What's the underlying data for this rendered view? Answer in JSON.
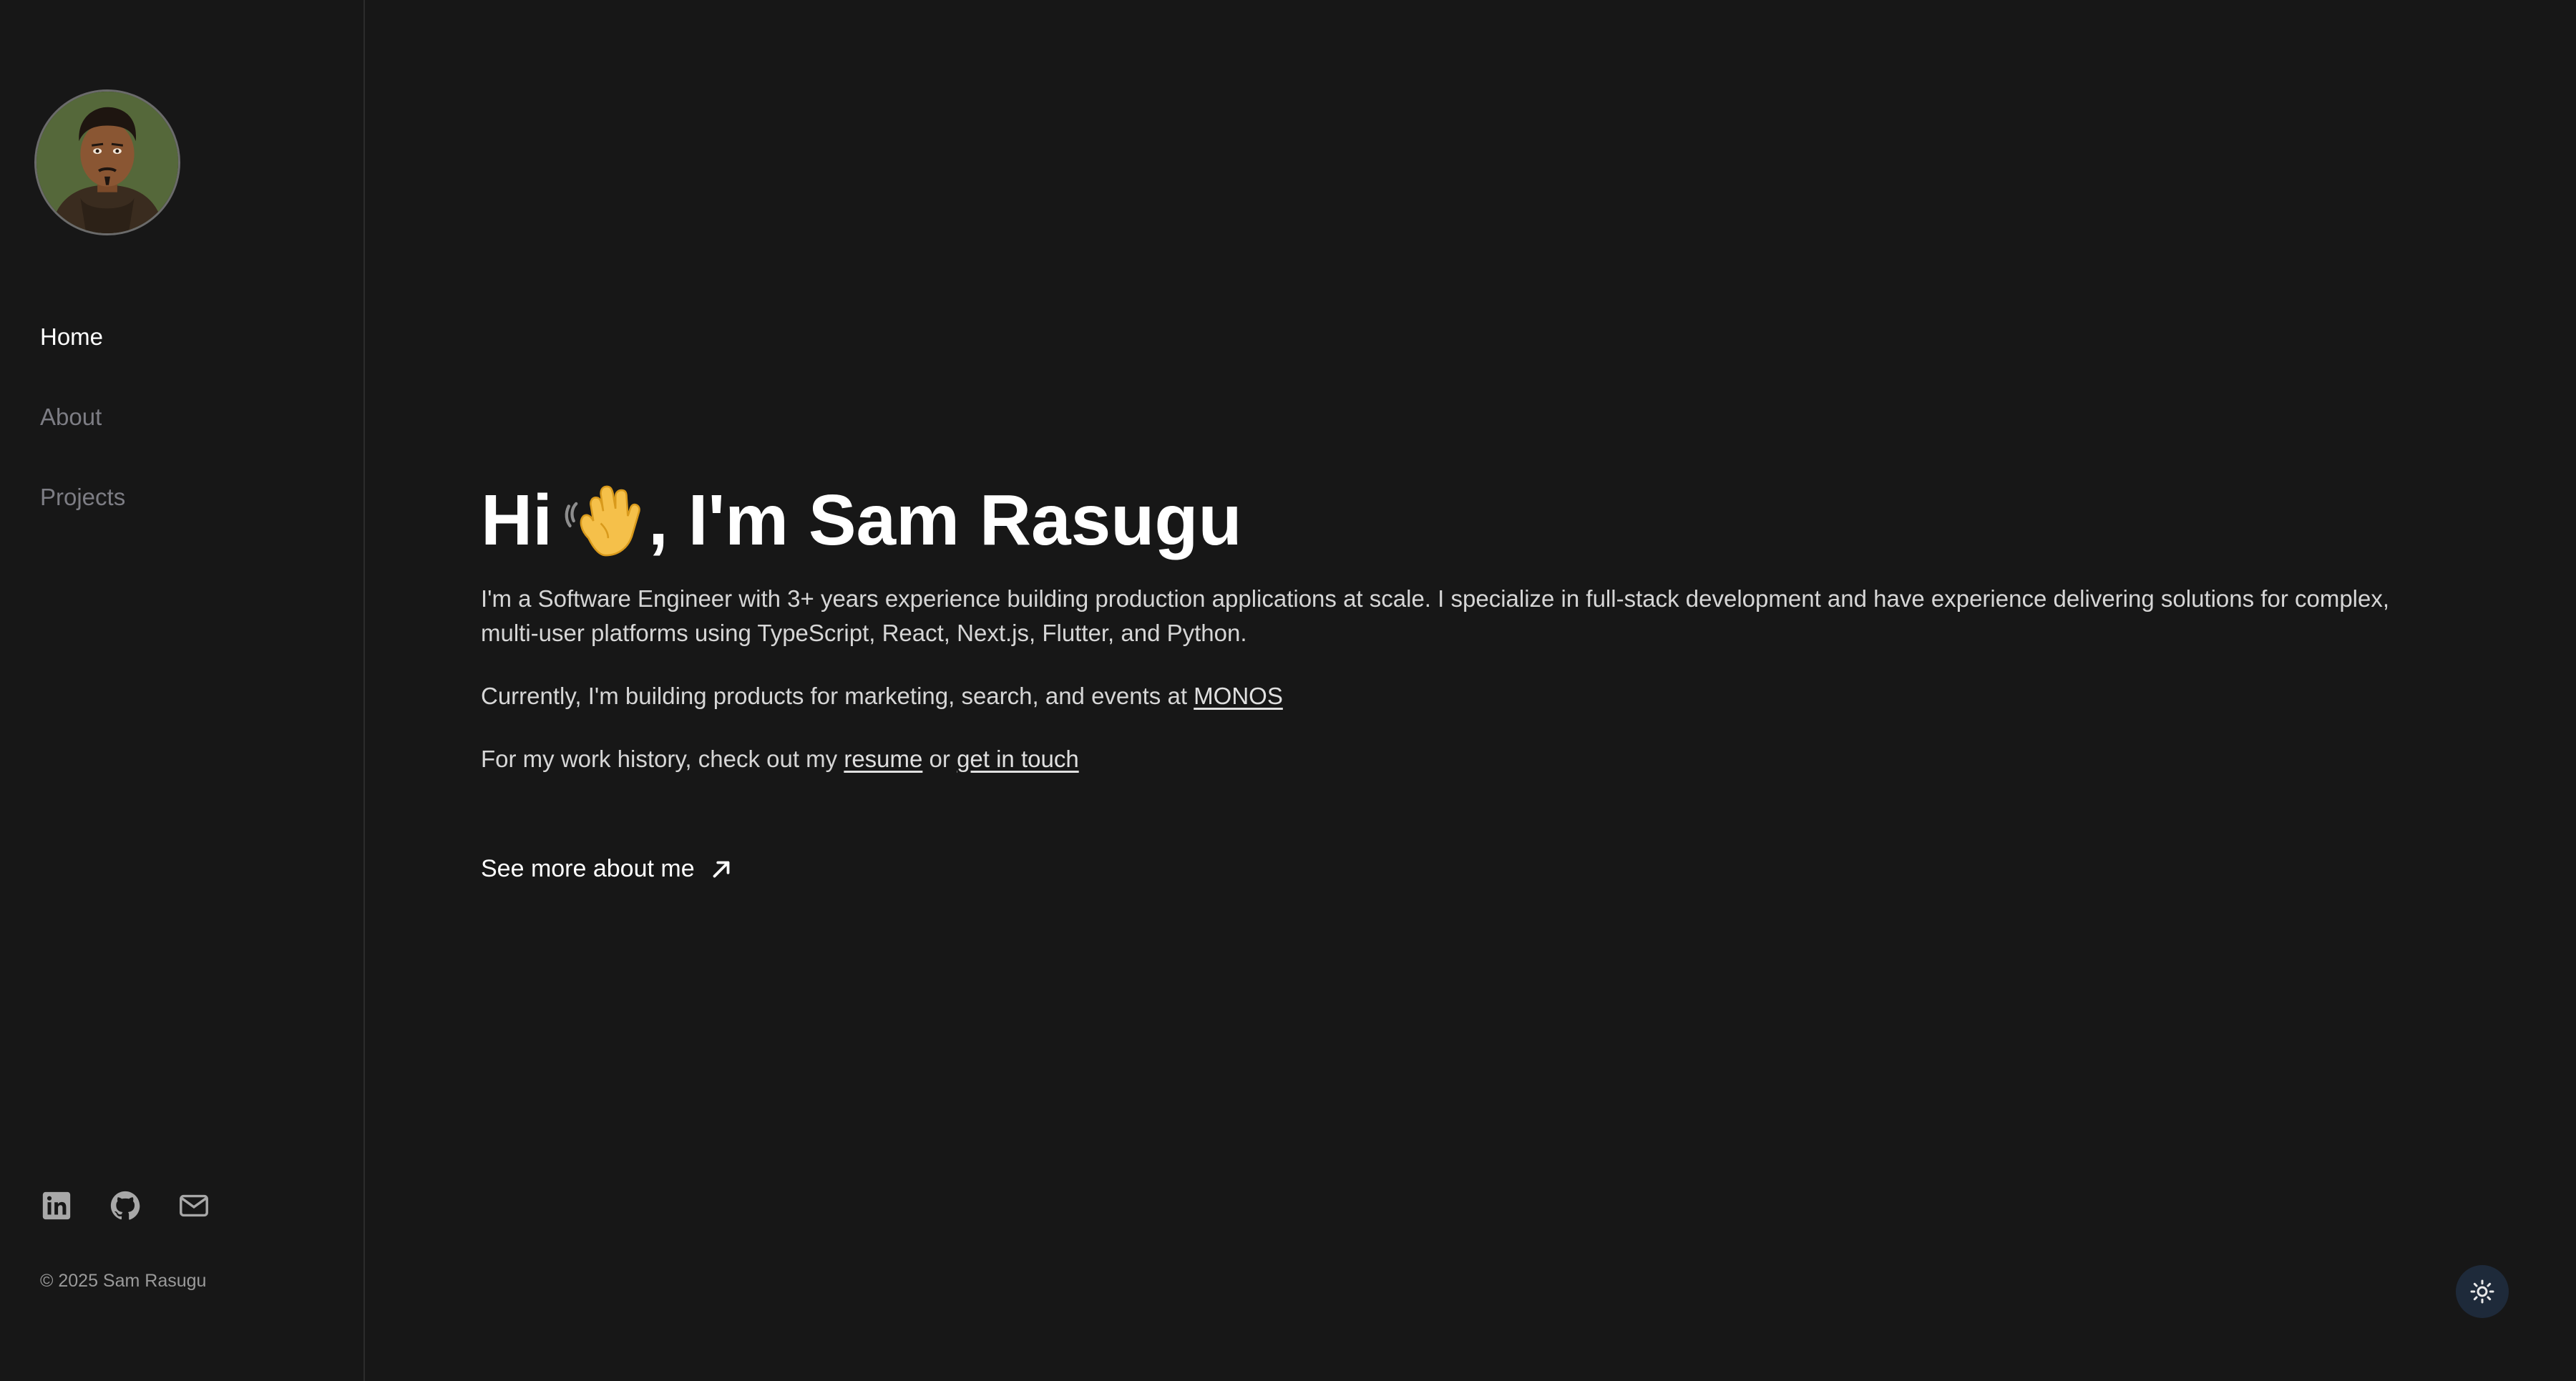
{
  "sidebar": {
    "avatar_icon": "avatar-illustration",
    "nav": [
      {
        "label": "Home",
        "active": true
      },
      {
        "label": "About",
        "active": false
      },
      {
        "label": "Projects",
        "active": false
      }
    ],
    "social": [
      {
        "icon": "linkedin-icon"
      },
      {
        "icon": "github-icon"
      },
      {
        "icon": "mail-icon"
      }
    ],
    "copyright": "© 2025 Sam Rasugu"
  },
  "main": {
    "heading_pre": "Hi",
    "heading_emoji": "waving-hand-icon",
    "heading_post": ", I'm Sam Rasugu",
    "intro": "I'm a Software Engineer with 3+ years experience building production applications at scale. I specialize in full-stack development and have experience delivering solutions for complex, multi-user platforms using TypeScript, React, Next.js, Flutter, and Python.",
    "current_text": "Currently, I'm building products for marketing, search, and events at ",
    "current_link": "MONOS",
    "history_text": "For my work history, check out my ",
    "resume_link": "resume",
    "or_text": " or ",
    "contact_link": "get in touch",
    "see_more": "See more about me"
  },
  "theme_toggle_icon": "sun-icon",
  "colors": {
    "background": "#171717",
    "text_primary": "#ffffff",
    "text_muted": "#7d7d84",
    "toggle_bg": "#1e2a3a"
  }
}
